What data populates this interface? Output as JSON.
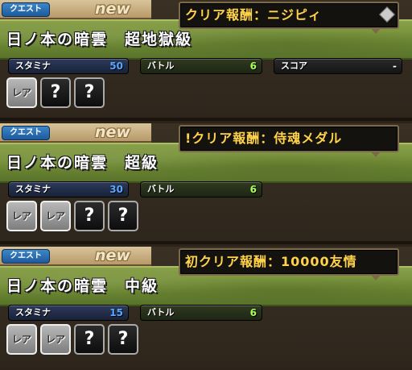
{
  "cards": [
    {
      "quest_tag": "クエスト",
      "new_label": "new",
      "title": "日ノ本の暗雲　超地獄級",
      "reward": "クリア報酬：ニジピィ",
      "stamina_label": "スタミナ",
      "stamina_value": "50",
      "battle_label": "バトル",
      "battle_value": "6",
      "score_label": "スコア",
      "score_value": "-",
      "drops": [
        "レア",
        "?",
        "?"
      ]
    },
    {
      "quest_tag": "クエスト",
      "new_label": "new",
      "title": "日ノ本の暗雲　超級",
      "reward": "!クリア報酬：侍魂メダル",
      "stamina_label": "スタミナ",
      "stamina_value": "30",
      "battle_label": "バトル",
      "battle_value": "6",
      "drops": [
        "レア",
        "レア",
        "?",
        "?"
      ]
    },
    {
      "quest_tag": "クエスト",
      "new_label": "new",
      "title": "日ノ本の暗雲　中級",
      "reward": "初クリア報酬：10000友情",
      "stamina_label": "スタミナ",
      "stamina_value": "15",
      "battle_label": "バトル",
      "battle_value": "6",
      "drops": [
        "レア",
        "レア",
        "?",
        "?"
      ]
    }
  ]
}
